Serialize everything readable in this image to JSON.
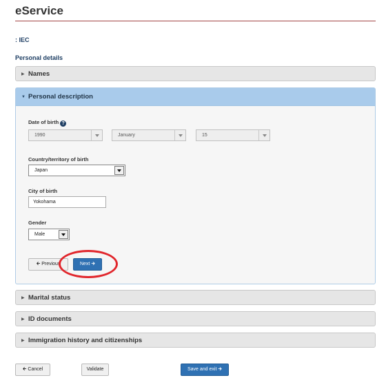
{
  "header": {
    "title": "eService"
  },
  "program": {
    "label": ": IEC"
  },
  "section": {
    "heading": "Personal details"
  },
  "accordion": {
    "names": "Names",
    "personal_description": "Personal description",
    "marital_status": "Marital status",
    "id_documents": "ID documents",
    "immigration": "Immigration history and citizenships"
  },
  "form": {
    "dob_label": "Date of birth",
    "dob_year": "1990",
    "dob_month": "January",
    "dob_day": "15",
    "country_label": "Country/territory of birth",
    "country_value": "Japan",
    "city_label": "City of birth",
    "city_value": "Yokohama",
    "gender_label": "Gender",
    "gender_value": "Male"
  },
  "nav": {
    "previous": "Previous",
    "next": "Next"
  },
  "footer": {
    "cancel": "Cancel",
    "validate": "Validate",
    "save_exit": "Save and exit"
  },
  "icons": {
    "collapsed": "caret-right-icon",
    "expanded": "caret-down-icon",
    "help": "question-circle-icon",
    "arrow_left": "arrow-left-icon",
    "arrow_right": "arrow-right-icon"
  },
  "colors": {
    "accent": "#2f71b3",
    "panel_header": "#a9cbeb",
    "title_rule": "#a04040",
    "highlight": "#e1262c"
  }
}
